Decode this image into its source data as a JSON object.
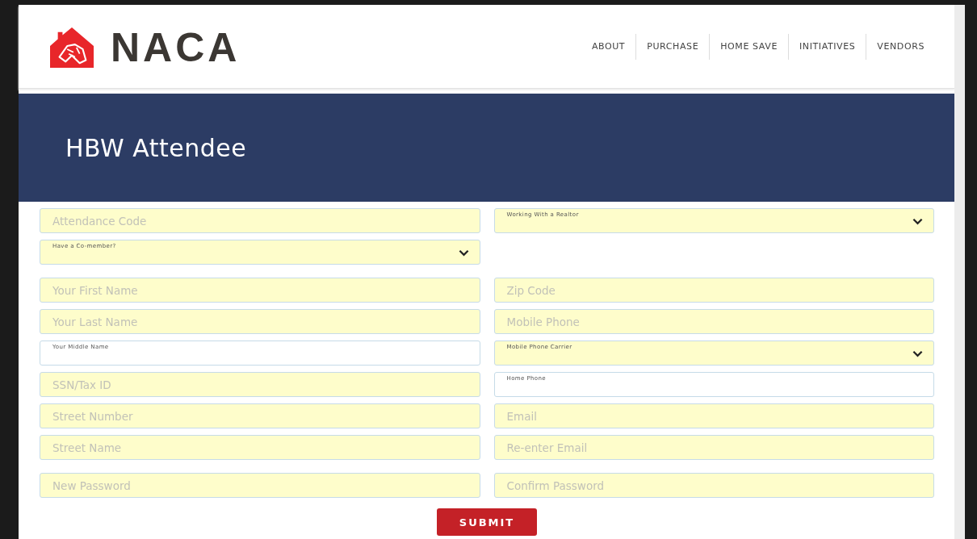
{
  "logo": {
    "text": "NACA"
  },
  "nav": [
    {
      "label": "ABOUT"
    },
    {
      "label": "PURCHASE"
    },
    {
      "label": "HOME SAVE"
    },
    {
      "label": "INITIATIVES"
    },
    {
      "label": "VENDORS"
    }
  ],
  "banner": {
    "title": "HBW Attendee"
  },
  "form_rows": [
    {
      "left": {
        "kind": "input",
        "placeholder": "Attendance Code",
        "autofilled": true
      },
      "right": {
        "kind": "select",
        "label": "Working With a Realtor",
        "autofilled": true
      }
    },
    {
      "left": {
        "kind": "select",
        "label": "Have a Co-member?",
        "autofilled": true
      }
    },
    {
      "gap": true,
      "left": {
        "kind": "input",
        "placeholder": "Your First Name",
        "autofilled": true
      },
      "right": {
        "kind": "input",
        "placeholder": "Zip Code",
        "autofilled": true
      }
    },
    {
      "left": {
        "kind": "input",
        "placeholder": "Your Last Name",
        "autofilled": true
      },
      "right": {
        "kind": "input",
        "placeholder": "Mobile Phone",
        "autofilled": true
      }
    },
    {
      "left": {
        "kind": "labeled",
        "label": "Your Middle Name",
        "autofilled": false
      },
      "right": {
        "kind": "select",
        "label": "Mobile Phone Carrier",
        "autofilled": true
      }
    },
    {
      "left": {
        "kind": "input",
        "placeholder": "SSN/Tax ID",
        "autofilled": true
      },
      "right": {
        "kind": "labeled",
        "label": "Home Phone",
        "autofilled": false
      }
    },
    {
      "left": {
        "kind": "input",
        "placeholder": "Street Number",
        "autofilled": true
      },
      "right": {
        "kind": "input",
        "placeholder": "Email",
        "autofilled": true
      }
    },
    {
      "left": {
        "kind": "input",
        "placeholder": "Street Name",
        "autofilled": true
      },
      "right": {
        "kind": "input",
        "placeholder": "Re-enter Email",
        "autofilled": true
      }
    },
    {
      "gap": true,
      "left": {
        "kind": "input",
        "placeholder": "New Password",
        "autofilled": true
      },
      "right": {
        "kind": "input",
        "placeholder": "Confirm Password",
        "autofilled": true
      }
    }
  ],
  "submit": {
    "label": "SUBMIT"
  }
}
